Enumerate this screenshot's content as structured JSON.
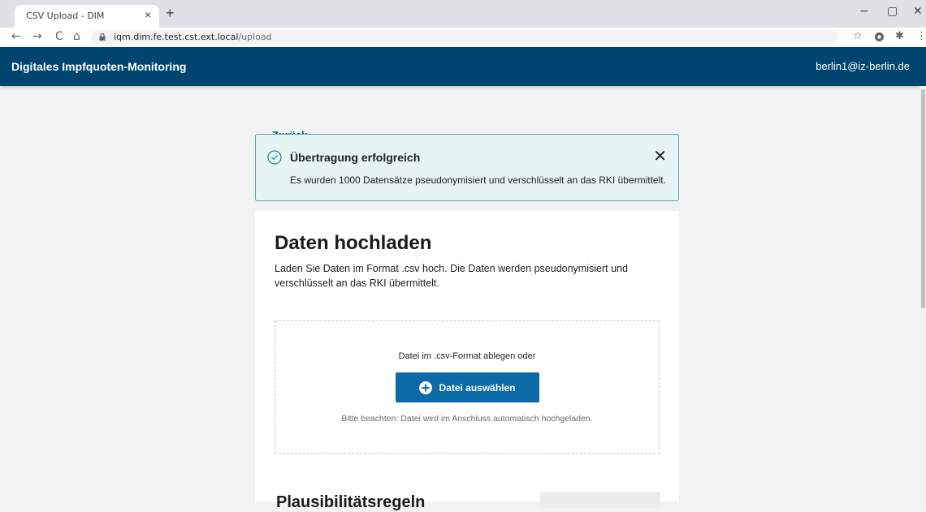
{
  "browser": {
    "tab_title": "CSV Upload - DIM",
    "tab_close": "×",
    "new_tab": "+",
    "url_host": "iqm.dim.fe.test.cst.ext.local",
    "url_path": "/upload",
    "minimize": "−",
    "restore": "▢",
    "close": "✕",
    "back": "←",
    "forward": "→",
    "reload": "C",
    "home": "⌂",
    "star": "☆",
    "extensions": "✱",
    "menu": "⋮"
  },
  "header": {
    "title": "Digitales Impfquoten-Monitoring",
    "user": "berlin1@iz-berlin.de",
    "color": "#004570"
  },
  "back_link": {
    "arrow": "←",
    "label": "Zurück"
  },
  "alert": {
    "title": "Übertragung erfolgreich",
    "text": "Es wurden 1000 Datensätze pseudonymisiert und verschlüsselt an das RKI übermittelt.",
    "close": "✕",
    "icon": "check-circle-icon"
  },
  "upload": {
    "title": "Daten hochladen",
    "description": "Laden Sie Daten im Format .csv hoch. Die Daten werden pseudonymisiert und verschlüsselt an das RKI übermittelt.",
    "dropzone_text": "Datei im .csv-Format ablegen oder",
    "button_label": "Datei auswählen",
    "note": "Bitte beachten: Datei wird im Anschluss automatisch hochgeladen.",
    "button_color": "#0c6aa6"
  },
  "rules": {
    "title": "Plausibilitätsregeln"
  }
}
